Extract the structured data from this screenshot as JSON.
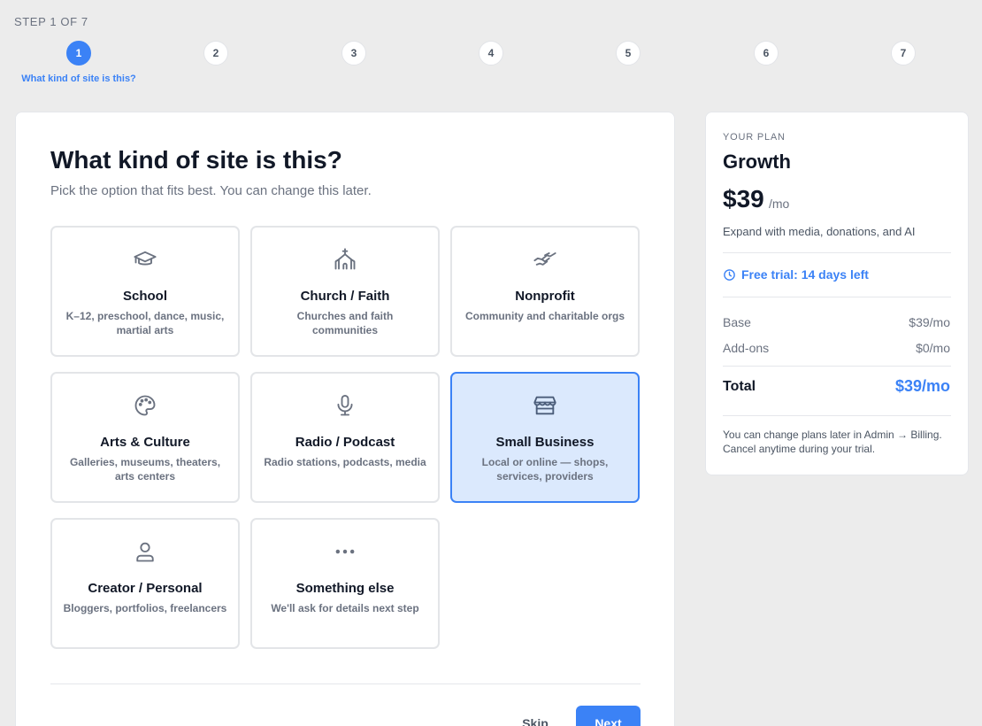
{
  "progress": {
    "label": "STEP 1 OF 7",
    "current_step": 1,
    "steps": [
      "1",
      "2",
      "3",
      "4",
      "5",
      "6",
      "7"
    ],
    "active_caption": "What kind of site is this?"
  },
  "main": {
    "title": "What kind of site is this?",
    "subtitle": "Pick the option that fits best. You can change this later.",
    "options": [
      {
        "title": "School",
        "description": "K–12, preschool, dance, music, martial arts",
        "icon": "graduation-cap-icon",
        "selected": false
      },
      {
        "title": "Church / Faith",
        "description": "Churches and faith communities",
        "icon": "church-icon",
        "selected": false
      },
      {
        "title": "Nonprofit",
        "description": "Community and charitable orgs",
        "icon": "handshake-icon",
        "selected": false
      },
      {
        "title": "Arts & Culture",
        "description": "Galleries, museums, theaters, arts centers",
        "icon": "palette-icon",
        "selected": false
      },
      {
        "title": "Radio / Podcast",
        "description": "Radio stations, podcasts, media",
        "icon": "microphone-icon",
        "selected": false
      },
      {
        "title": "Small Business",
        "description": "Local or online — shops, services, providers",
        "icon": "storefront-icon",
        "selected": true
      },
      {
        "title": "Creator / Personal",
        "description": "Bloggers, portfolios, freelancers",
        "icon": "person-icon",
        "selected": false
      },
      {
        "title": "Something else",
        "description": "We'll ask for details next step",
        "icon": "more-dots-icon",
        "selected": false
      }
    ],
    "skip_label": "Skip",
    "next_label": "Next"
  },
  "plan": {
    "eyebrow": "YOUR PLAN",
    "name": "Growth",
    "price": "$39",
    "period": "/mo",
    "description": "Expand with media, donations, and AI",
    "trial": "Free trial: 14 days left",
    "rows": [
      {
        "label": "Base",
        "value": "$39/mo"
      },
      {
        "label": "Add-ons",
        "value": "$0/mo"
      }
    ],
    "total_label": "Total",
    "total_value": "$39/mo",
    "note": "You can change plans later in Admin → Billing. Cancel anytime during your trial."
  },
  "colors": {
    "accent": "#3b82f6",
    "selected_bg": "#dbe9fd",
    "page_bg": "#ececec"
  }
}
